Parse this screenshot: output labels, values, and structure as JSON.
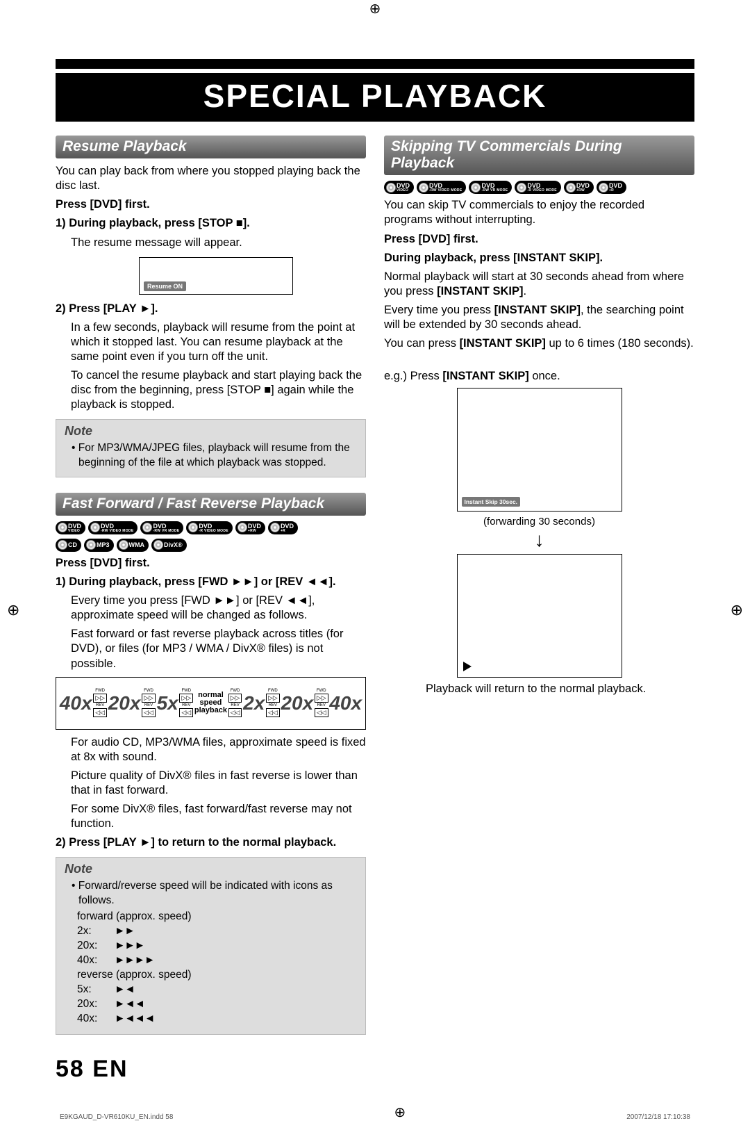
{
  "page": {
    "title": "SPECIAL PLAYBACK",
    "number": "58",
    "lang": "EN",
    "footer_left": "E9KGAUD_D-VR610KU_EN.indd   58",
    "footer_right": "2007/12/18   17:10:38",
    "reg_mark": "⊕"
  },
  "left": {
    "sec1_title": "Resume Playback",
    "sec1_intro": "You can play back from where you stopped playing back the disc last.",
    "press_dvd": "Press [DVD] first.",
    "step1": "1) During playback, press [STOP ■].",
    "step1_body": "The resume message will appear.",
    "resume_on": "Resume ON",
    "step2": "2) Press [PLAY ►].",
    "step2_body1": "In a few seconds, playback will resume from the point at which it stopped last. You can resume playback at the same point even if you turn off the unit.",
    "step2_body2": "To cancel the resume playback and start playing back the disc from the beginning, press [STOP ■] again while the playback is stopped.",
    "note_title": "Note",
    "note_item": "For MP3/WMA/JPEG files, playback will resume from the beginning of the file at which playback was stopped.",
    "sec2_title": "Fast Forward / Fast Reverse Playback",
    "discs1": [
      "DVD VIDEO",
      "DVD -RW VIDEO MODE",
      "DVD -RW VR MODE",
      "DVD -R VIDEO MODE",
      "DVD +RW",
      "DVD +R"
    ],
    "discs2": [
      "CD",
      "MP3",
      "WMA",
      "DivX®"
    ],
    "press_dvd2": "Press [DVD] first.",
    "step_b1": "1) During playback, press [FWD ►►] or [REV ◄◄].",
    "step_b1_body1": "Every time you press [FWD ►►] or [REV ◄◄], approximate speed will be changed as follows.",
    "step_b1_body2": "Fast forward or fast reverse playback across titles (for DVD), or files (for MP3 / WMA / DivX® files) is not possible.",
    "speeds": [
      "40x",
      "20x",
      "5x",
      "normal speed playback",
      "2x",
      "20x",
      "40x"
    ],
    "after1": "For audio CD, MP3/WMA files, approximate speed is fixed at 8x with sound.",
    "after2": "Picture quality of DivX® files in fast reverse is lower than that in fast forward.",
    "after3": "For some DivX® files, fast forward/fast reverse may not function.",
    "step_b2": "2) Press [PLAY ►] to return to the normal playback.",
    "note2_title": "Note",
    "note2_intro": "Forward/reverse speed will be indicated with icons as follows.",
    "fwd_label": "forward (approx. speed)",
    "fwd_rows": [
      {
        "label": "2x:",
        "icon": "►►"
      },
      {
        "label": "20x:",
        "icon": "►►►"
      },
      {
        "label": "40x:",
        "icon": "►►►►"
      }
    ],
    "rev_label": "reverse (approx. speed)",
    "rev_rows": [
      {
        "label": "5x:",
        "icon": "►◄"
      },
      {
        "label": "20x:",
        "icon": "►◄◄"
      },
      {
        "label": "40x:",
        "icon": "►◄◄◄"
      }
    ]
  },
  "right": {
    "sec1_title": "Skipping TV Commercials During Playback",
    "discs": [
      "DVD VIDEO",
      "DVD -RW VIDEO MODE",
      "DVD -RW VR MODE",
      "DVD -R VIDEO MODE",
      "DVD +RW",
      "DVD +R"
    ],
    "intro": "You can skip TV commercials to enjoy the recorded programs without interrupting.",
    "press_dvd": "Press [DVD] first.",
    "step": "During playback, press [INSTANT SKIP].",
    "body1a": "Normal playback will start at 30 seconds ahead from where you press ",
    "body1b": "[INSTANT SKIP]",
    "body1c": ".",
    "body2a": "Every time you press ",
    "body2b": "[INSTANT SKIP]",
    "body2c": ", the searching point will be extended by 30 seconds ahead.",
    "body3a": "You can press ",
    "body3b": "[INSTANT SKIP]",
    "body3c": " up to 6 times (180 seconds).",
    "eg_label": "e.g.) Press ",
    "eg_bold": "[INSTANT SKIP]",
    "eg_tail": " once.",
    "skip_msg": "Instant Skip 30sec.",
    "fwd30": "(forwarding 30 seconds)",
    "arrow": "↓",
    "outro": "Playback will return to the normal playback."
  }
}
